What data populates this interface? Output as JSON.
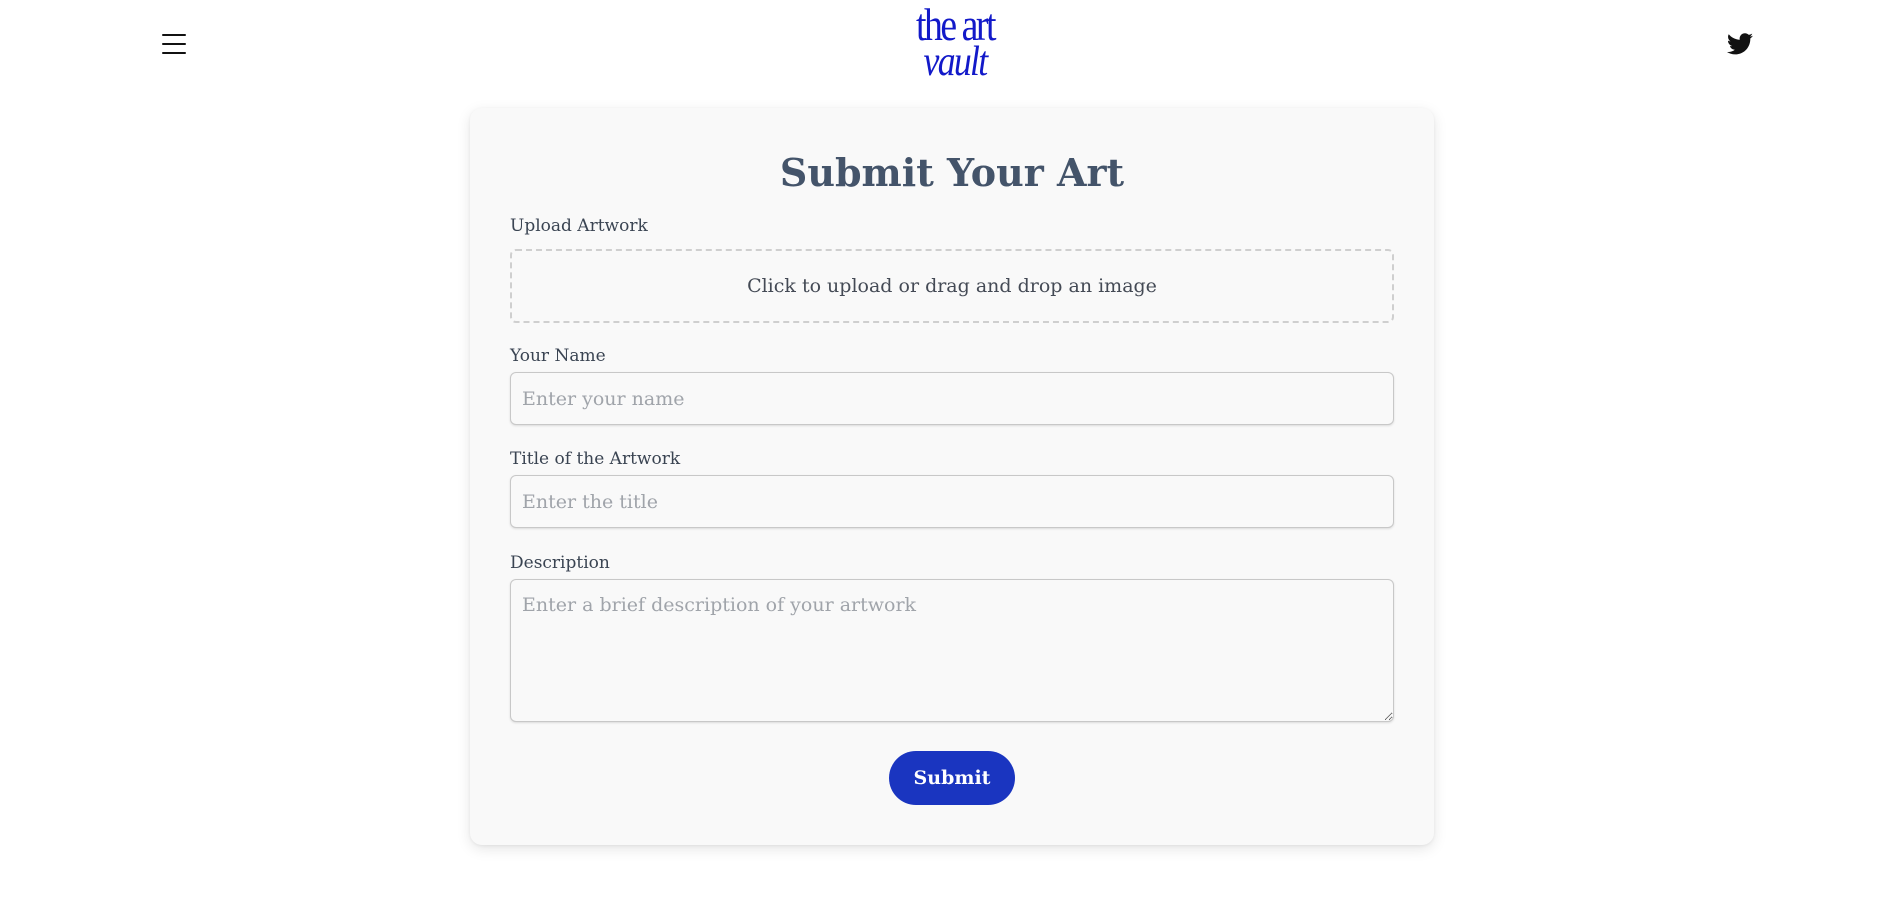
{
  "header": {
    "logo": {
      "line1": "the art",
      "line2": "vault"
    },
    "brand_color": "#1219c9",
    "menu_icon": "hamburger-menu-icon",
    "social_icon": "twitter-icon"
  },
  "form": {
    "title": "Submit Your Art",
    "upload": {
      "label": "Upload Artwork",
      "prompt": "Click to upload or drag and drop an image"
    },
    "name": {
      "label": "Your Name",
      "placeholder": "Enter your name",
      "value": ""
    },
    "artwork_title": {
      "label": "Title of the Artwork",
      "placeholder": "Enter the title",
      "value": ""
    },
    "description": {
      "label": "Description",
      "placeholder": "Enter a brief description of your artwork",
      "value": ""
    },
    "submit_label": "Submit",
    "submit_color": "#1a35c0"
  }
}
